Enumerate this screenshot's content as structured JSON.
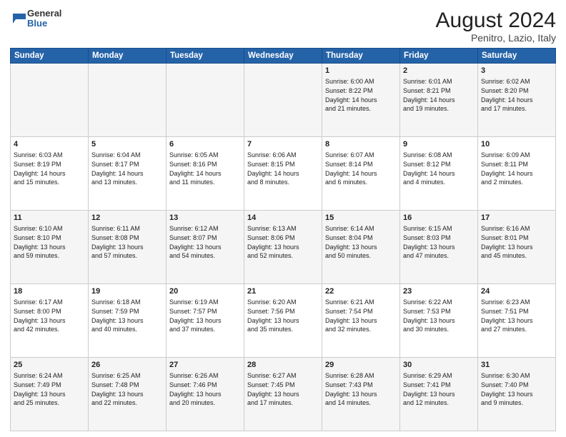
{
  "header": {
    "logo_general": "General",
    "logo_blue": "Blue",
    "title": "August 2024",
    "subtitle": "Penitro, Lazio, Italy"
  },
  "days_of_week": [
    "Sunday",
    "Monday",
    "Tuesday",
    "Wednesday",
    "Thursday",
    "Friday",
    "Saturday"
  ],
  "weeks": [
    [
      {
        "day": "",
        "content": ""
      },
      {
        "day": "",
        "content": ""
      },
      {
        "day": "",
        "content": ""
      },
      {
        "day": "",
        "content": ""
      },
      {
        "day": "1",
        "content": "Sunrise: 6:00 AM\nSunset: 8:22 PM\nDaylight: 14 hours\nand 21 minutes."
      },
      {
        "day": "2",
        "content": "Sunrise: 6:01 AM\nSunset: 8:21 PM\nDaylight: 14 hours\nand 19 minutes."
      },
      {
        "day": "3",
        "content": "Sunrise: 6:02 AM\nSunset: 8:20 PM\nDaylight: 14 hours\nand 17 minutes."
      }
    ],
    [
      {
        "day": "4",
        "content": "Sunrise: 6:03 AM\nSunset: 8:19 PM\nDaylight: 14 hours\nand 15 minutes."
      },
      {
        "day": "5",
        "content": "Sunrise: 6:04 AM\nSunset: 8:17 PM\nDaylight: 14 hours\nand 13 minutes."
      },
      {
        "day": "6",
        "content": "Sunrise: 6:05 AM\nSunset: 8:16 PM\nDaylight: 14 hours\nand 11 minutes."
      },
      {
        "day": "7",
        "content": "Sunrise: 6:06 AM\nSunset: 8:15 PM\nDaylight: 14 hours\nand 8 minutes."
      },
      {
        "day": "8",
        "content": "Sunrise: 6:07 AM\nSunset: 8:14 PM\nDaylight: 14 hours\nand 6 minutes."
      },
      {
        "day": "9",
        "content": "Sunrise: 6:08 AM\nSunset: 8:12 PM\nDaylight: 14 hours\nand 4 minutes."
      },
      {
        "day": "10",
        "content": "Sunrise: 6:09 AM\nSunset: 8:11 PM\nDaylight: 14 hours\nand 2 minutes."
      }
    ],
    [
      {
        "day": "11",
        "content": "Sunrise: 6:10 AM\nSunset: 8:10 PM\nDaylight: 13 hours\nand 59 minutes."
      },
      {
        "day": "12",
        "content": "Sunrise: 6:11 AM\nSunset: 8:08 PM\nDaylight: 13 hours\nand 57 minutes."
      },
      {
        "day": "13",
        "content": "Sunrise: 6:12 AM\nSunset: 8:07 PM\nDaylight: 13 hours\nand 54 minutes."
      },
      {
        "day": "14",
        "content": "Sunrise: 6:13 AM\nSunset: 8:06 PM\nDaylight: 13 hours\nand 52 minutes."
      },
      {
        "day": "15",
        "content": "Sunrise: 6:14 AM\nSunset: 8:04 PM\nDaylight: 13 hours\nand 50 minutes."
      },
      {
        "day": "16",
        "content": "Sunrise: 6:15 AM\nSunset: 8:03 PM\nDaylight: 13 hours\nand 47 minutes."
      },
      {
        "day": "17",
        "content": "Sunrise: 6:16 AM\nSunset: 8:01 PM\nDaylight: 13 hours\nand 45 minutes."
      }
    ],
    [
      {
        "day": "18",
        "content": "Sunrise: 6:17 AM\nSunset: 8:00 PM\nDaylight: 13 hours\nand 42 minutes."
      },
      {
        "day": "19",
        "content": "Sunrise: 6:18 AM\nSunset: 7:59 PM\nDaylight: 13 hours\nand 40 minutes."
      },
      {
        "day": "20",
        "content": "Sunrise: 6:19 AM\nSunset: 7:57 PM\nDaylight: 13 hours\nand 37 minutes."
      },
      {
        "day": "21",
        "content": "Sunrise: 6:20 AM\nSunset: 7:56 PM\nDaylight: 13 hours\nand 35 minutes."
      },
      {
        "day": "22",
        "content": "Sunrise: 6:21 AM\nSunset: 7:54 PM\nDaylight: 13 hours\nand 32 minutes."
      },
      {
        "day": "23",
        "content": "Sunrise: 6:22 AM\nSunset: 7:53 PM\nDaylight: 13 hours\nand 30 minutes."
      },
      {
        "day": "24",
        "content": "Sunrise: 6:23 AM\nSunset: 7:51 PM\nDaylight: 13 hours\nand 27 minutes."
      }
    ],
    [
      {
        "day": "25",
        "content": "Sunrise: 6:24 AM\nSunset: 7:49 PM\nDaylight: 13 hours\nand 25 minutes."
      },
      {
        "day": "26",
        "content": "Sunrise: 6:25 AM\nSunset: 7:48 PM\nDaylight: 13 hours\nand 22 minutes."
      },
      {
        "day": "27",
        "content": "Sunrise: 6:26 AM\nSunset: 7:46 PM\nDaylight: 13 hours\nand 20 minutes."
      },
      {
        "day": "28",
        "content": "Sunrise: 6:27 AM\nSunset: 7:45 PM\nDaylight: 13 hours\nand 17 minutes."
      },
      {
        "day": "29",
        "content": "Sunrise: 6:28 AM\nSunset: 7:43 PM\nDaylight: 13 hours\nand 14 minutes."
      },
      {
        "day": "30",
        "content": "Sunrise: 6:29 AM\nSunset: 7:41 PM\nDaylight: 13 hours\nand 12 minutes."
      },
      {
        "day": "31",
        "content": "Sunrise: 6:30 AM\nSunset: 7:40 PM\nDaylight: 13 hours\nand 9 minutes."
      }
    ]
  ]
}
